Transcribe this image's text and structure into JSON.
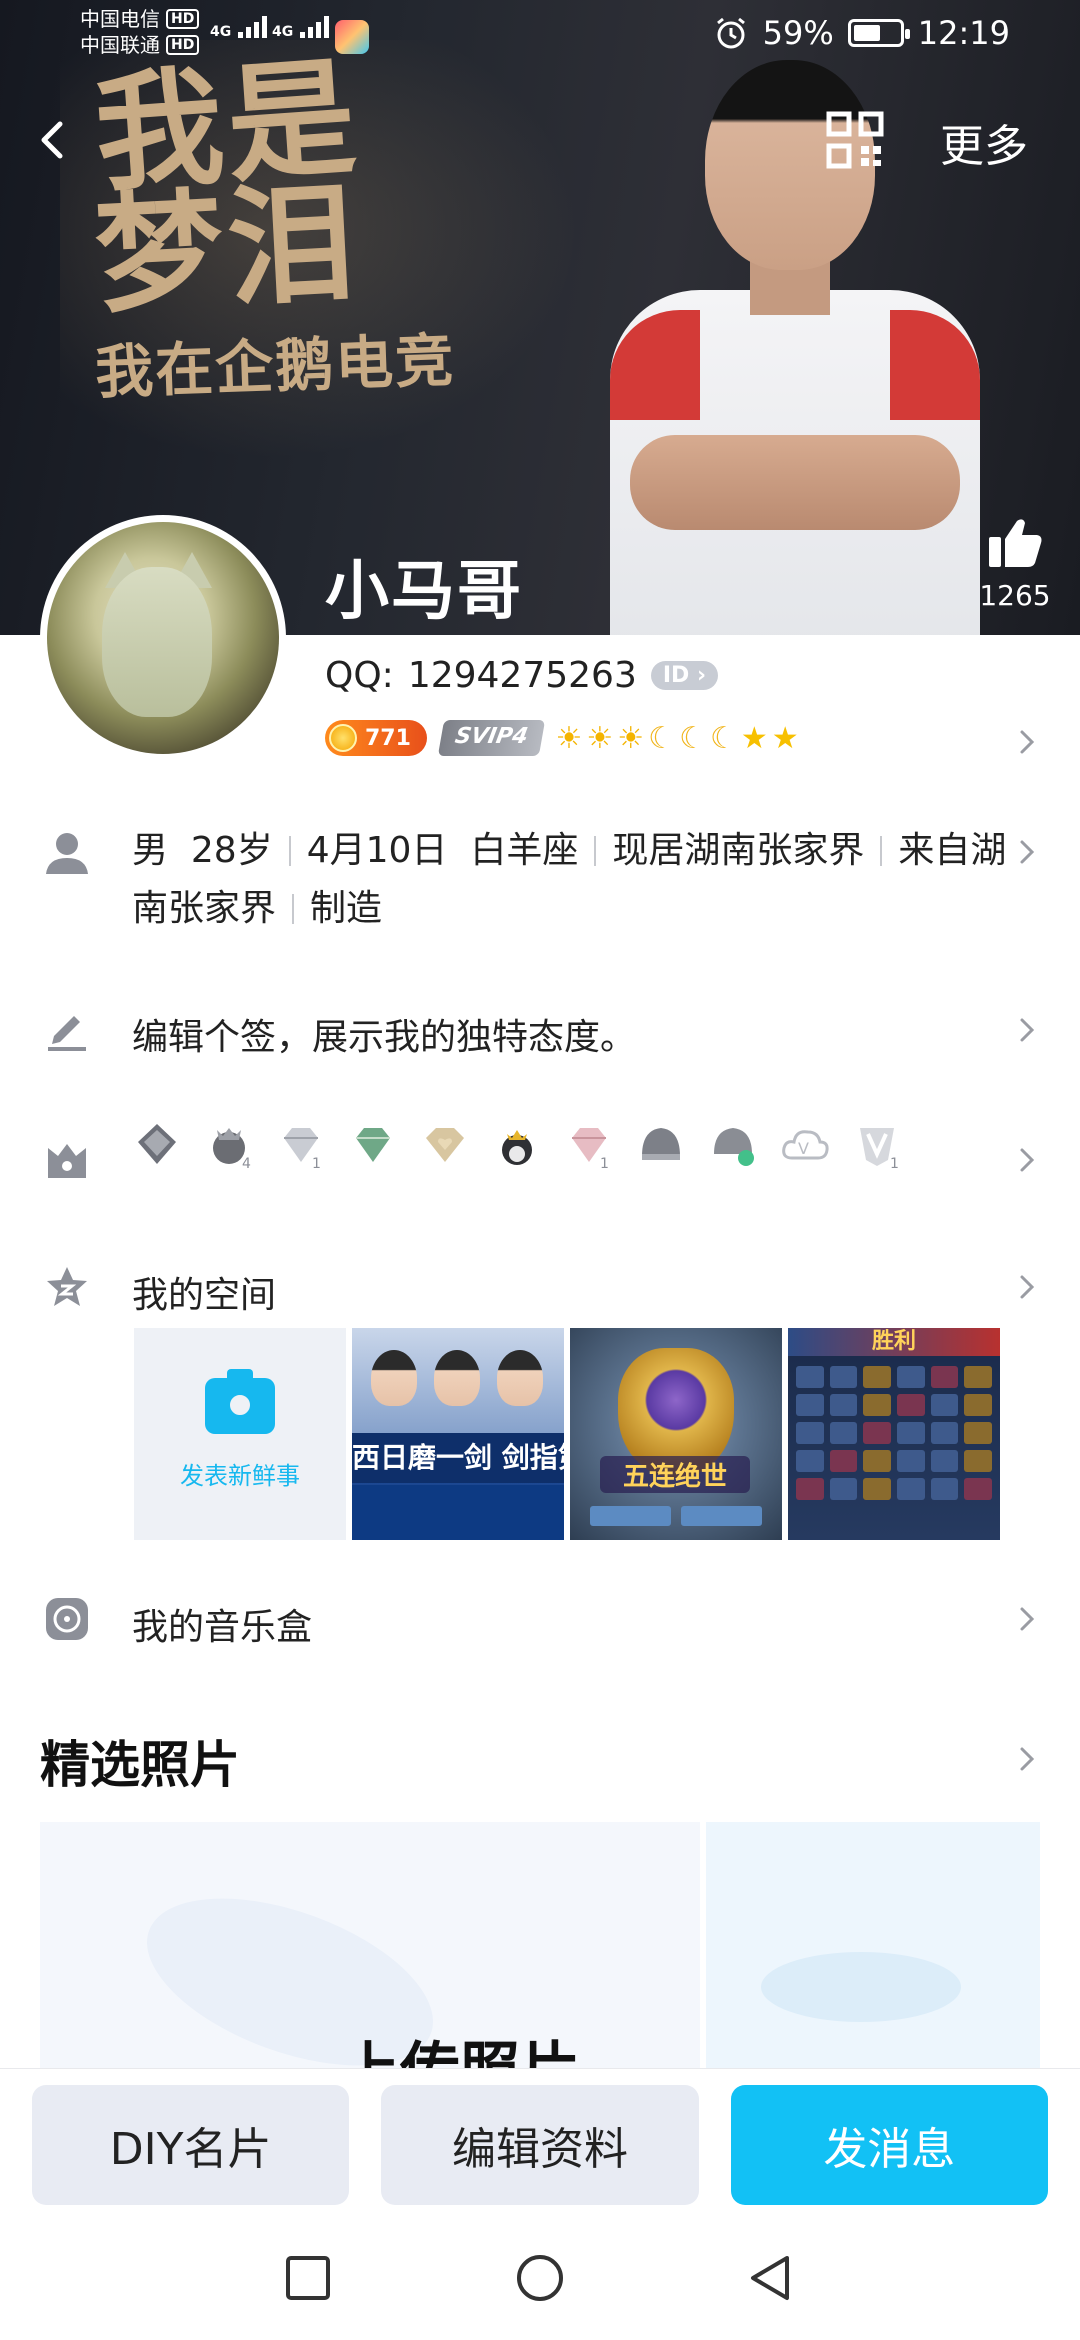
{
  "status_bar": {
    "carrier1": "中国电信",
    "carrier2": "中国联通",
    "hd": "HD",
    "network1": "4G",
    "network2": "4G",
    "battery_percent": "59%",
    "battery_level": 0.59,
    "time": "12:19"
  },
  "header": {
    "more_label": "更多",
    "banner_text": {
      "line1": "我是",
      "line2": "梦泪",
      "line3": "我在企鹅电竞"
    },
    "like_count": "1265"
  },
  "profile": {
    "nickname": "小马哥",
    "qq_label": "QQ:",
    "qq_number": "1294275263",
    "id_badge": "ID",
    "coin_count": "771",
    "svip": "SVIP4",
    "gender": "男",
    "age": "28岁",
    "birthday": "4月10日",
    "zodiac": "白羊座",
    "residence": "现居湖南张家界",
    "hometown": "来自湖南张家界",
    "occupation": "制造"
  },
  "signature": {
    "text": "编辑个签，展示我的独特态度。"
  },
  "space": {
    "title": "我的空间",
    "post_label": "发表新鲜事",
    "tile1_caption": "西日磨一剑 剑指第四冠",
    "tile2_caption": "五连绝世",
    "tile3_caption": "胜利"
  },
  "music": {
    "title": "我的音乐盒"
  },
  "photos": {
    "title": "精选照片",
    "upload_label": "上传照片"
  },
  "actions": {
    "diy_card": "DIY名片",
    "edit_profile": "编辑资料",
    "send_message": "发消息"
  },
  "colors": {
    "accent": "#12c1f5",
    "button_bg": "#e8ebf3",
    "icon_gray": "#8c8f98"
  }
}
